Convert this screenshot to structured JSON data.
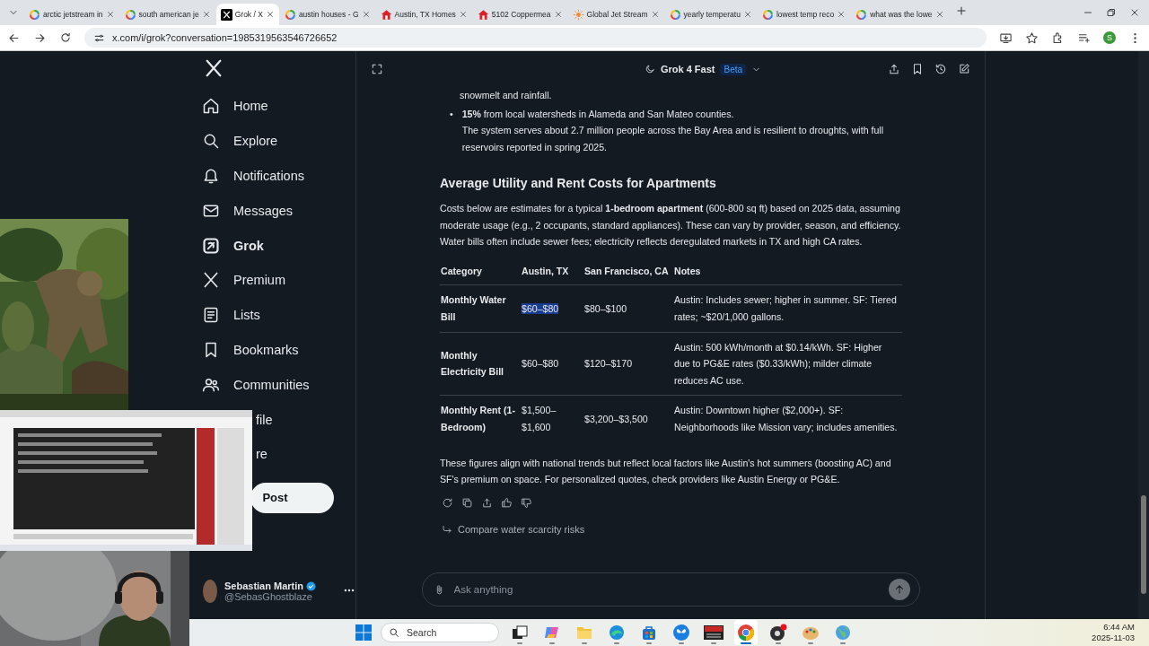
{
  "browser": {
    "tabs": [
      {
        "title": "arctic jetstream in",
        "kind": "ring",
        "selected": false
      },
      {
        "title": "south american je",
        "kind": "ring",
        "selected": false
      },
      {
        "title": "Grok / X",
        "kind": "x",
        "selected": true
      },
      {
        "title": "austin houses - G",
        "kind": "ring",
        "selected": false
      },
      {
        "title": "Austin, TX Homes",
        "kind": "house",
        "selected": false
      },
      {
        "title": "5102 Coppermea",
        "kind": "house",
        "selected": false
      },
      {
        "title": "Global Jet Stream",
        "kind": "sun",
        "selected": false
      },
      {
        "title": "yearly temperatu",
        "kind": "ring",
        "selected": false
      },
      {
        "title": "lowest temp reco",
        "kind": "ring",
        "selected": false
      },
      {
        "title": "what was the lowe",
        "kind": "ring",
        "selected": false
      }
    ],
    "url": "x.com/i/grok?conversation=1985319563546726652",
    "profile_letter": "S"
  },
  "sidebar": {
    "items": [
      {
        "label": "Home",
        "kind": "home",
        "selected": false
      },
      {
        "label": "Explore",
        "kind": "search",
        "selected": false
      },
      {
        "label": "Notifications",
        "kind": "bell",
        "selected": false
      },
      {
        "label": "Messages",
        "kind": "mail",
        "selected": false
      },
      {
        "label": "Grok",
        "kind": "grok",
        "selected": true
      },
      {
        "label": "Premium",
        "kind": "x",
        "selected": false
      },
      {
        "label": "Lists",
        "kind": "list",
        "selected": false
      },
      {
        "label": "Bookmarks",
        "kind": "bookmark",
        "selected": false
      },
      {
        "label": "Communities",
        "kind": "people",
        "selected": false
      },
      {
        "label": "file",
        "kind": "covered",
        "selected": false
      },
      {
        "label": "re",
        "kind": "covered",
        "selected": false
      }
    ],
    "post_button": "Post",
    "user": {
      "name": "Sebastian Martin",
      "handle": "@SebasGhostblaze",
      "verified": true
    }
  },
  "chat": {
    "model": "Grok 4 Fast",
    "badge": "Beta",
    "blocks": [
      {
        "kind": "continuation",
        "text": "snowmelt and rainfall."
      },
      {
        "kind": "bullet",
        "marker": "•",
        "text": "**15%** from local watersheds in Alameda and San Mateo counties.",
        "detail": "The system serves about 2.7 million people across the Bay Area and is resilient to droughts, with full reservoirs reported in spring 2025."
      },
      {
        "kind": "heading",
        "text": "Average Utility and Rent Costs for Apartments"
      },
      {
        "kind": "paragraph",
        "text": "Costs below are estimates for a typical **1-bedroom apartment** (600-800 sq ft) based on 2025 data, assuming moderate usage (e.g., 2 occupants, standard appliances). These can vary by provider, season, and efficiency. Water bills often include sewer fees; electricity reflects deregulated markets in TX and high CA rates."
      },
      {
        "kind": "table",
        "columns": [
          "Category",
          "Austin, TX",
          "San Francisco, CA",
          "Notes"
        ],
        "rows": [
          {
            "cells": [
              {
                "text": "Monthly Water Bill",
                "highlighted": false
              },
              {
                "text": "$60–$80",
                "highlighted": true
              },
              {
                "text": "$80–$100",
                "highlighted": false
              },
              {
                "text": "Austin: Includes sewer; higher in summer. SF: Tiered rates; ~$20/1,000 gallons.",
                "highlighted": false
              }
            ]
          },
          {
            "cells": [
              {
                "text": "Monthly Electricity Bill",
                "highlighted": false
              },
              {
                "text": "$60–$80",
                "highlighted": false
              },
              {
                "text": "$120–$170",
                "highlighted": false
              },
              {
                "text": "Austin: 500 kWh/month at $0.14/kWh. SF: Higher due to PG&E rates ($0.33/kWh); milder climate reduces AC use.",
                "highlighted": false
              }
            ]
          },
          {
            "cells": [
              {
                "text": "Monthly Rent (1-Bedroom)",
                "highlighted": false
              },
              {
                "text": "$1,500–$1,600",
                "highlighted": false
              },
              {
                "text": "$3,200–$3,500",
                "highlighted": false
              },
              {
                "text": "Austin: Downtown higher ($2,000+). SF: Neighborhoods like Mission vary; includes amenities.",
                "highlighted": false
              }
            ]
          }
        ]
      },
      {
        "kind": "paragraph",
        "text": "These figures align with national trends but reflect local factors like Austin's hot summers (boosting AC) and SF's premium on space. For personalized quotes, check providers like Austin Energy or PG&E."
      }
    ],
    "suggestion": "Compare water scarcity risks",
    "input": {
      "placeholder": "Ask anything"
    }
  },
  "taskbar": {
    "search": {
      "placeholder": "Search"
    },
    "apps": [
      {
        "kind": "taskview",
        "active": false
      },
      {
        "kind": "copilot",
        "active": false
      },
      {
        "kind": "folder",
        "active": false
      },
      {
        "kind": "edge",
        "active": false
      },
      {
        "kind": "store",
        "active": false
      },
      {
        "kind": "butterfly",
        "active": false
      },
      {
        "kind": "voice",
        "active": false
      },
      {
        "kind": "chrome",
        "active": true
      },
      {
        "kind": "recorder",
        "active": false
      },
      {
        "kind": "palette",
        "active": false
      },
      {
        "kind": "globe",
        "active": false
      }
    ],
    "time": "6:44 AM",
    "date": "2025-11-03"
  }
}
